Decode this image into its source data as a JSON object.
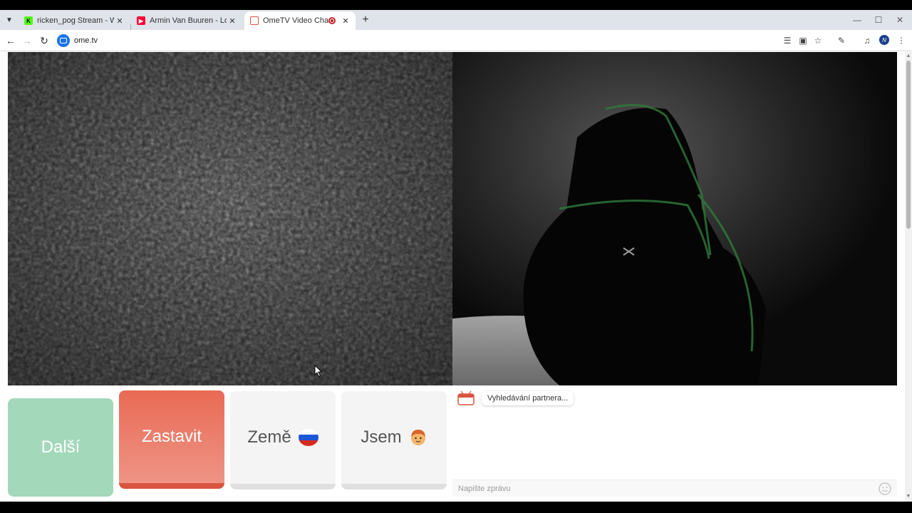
{
  "browser": {
    "tabs": [
      {
        "title": "ricken_pog Stream - Watch Live",
        "favicon": "kick-icon",
        "active": false
      },
      {
        "title": "Armin Van Buuren - Lose This Feeling",
        "favicon": "youtube-icon",
        "active": false
      },
      {
        "title": "OmeTV Video Chat — Omegle",
        "favicon": "ometv-icon",
        "active": true,
        "recording": true
      }
    ],
    "address": "ome.tv"
  },
  "controls": {
    "next_label": "Další",
    "stop_label": "Zastavit",
    "country_label": "Země",
    "gender_label": "Jsem",
    "country_flag": "russia-flag-icon",
    "gender_icon": "boy-face-icon"
  },
  "chat": {
    "logo_text": "Ome TV",
    "status_message": "Vyhledávání partnera...",
    "input_placeholder": "Napište zprávu"
  },
  "colors": {
    "next": "#a4d8bb",
    "stop": "#e86a54",
    "neutral": "#f4f4f4"
  }
}
